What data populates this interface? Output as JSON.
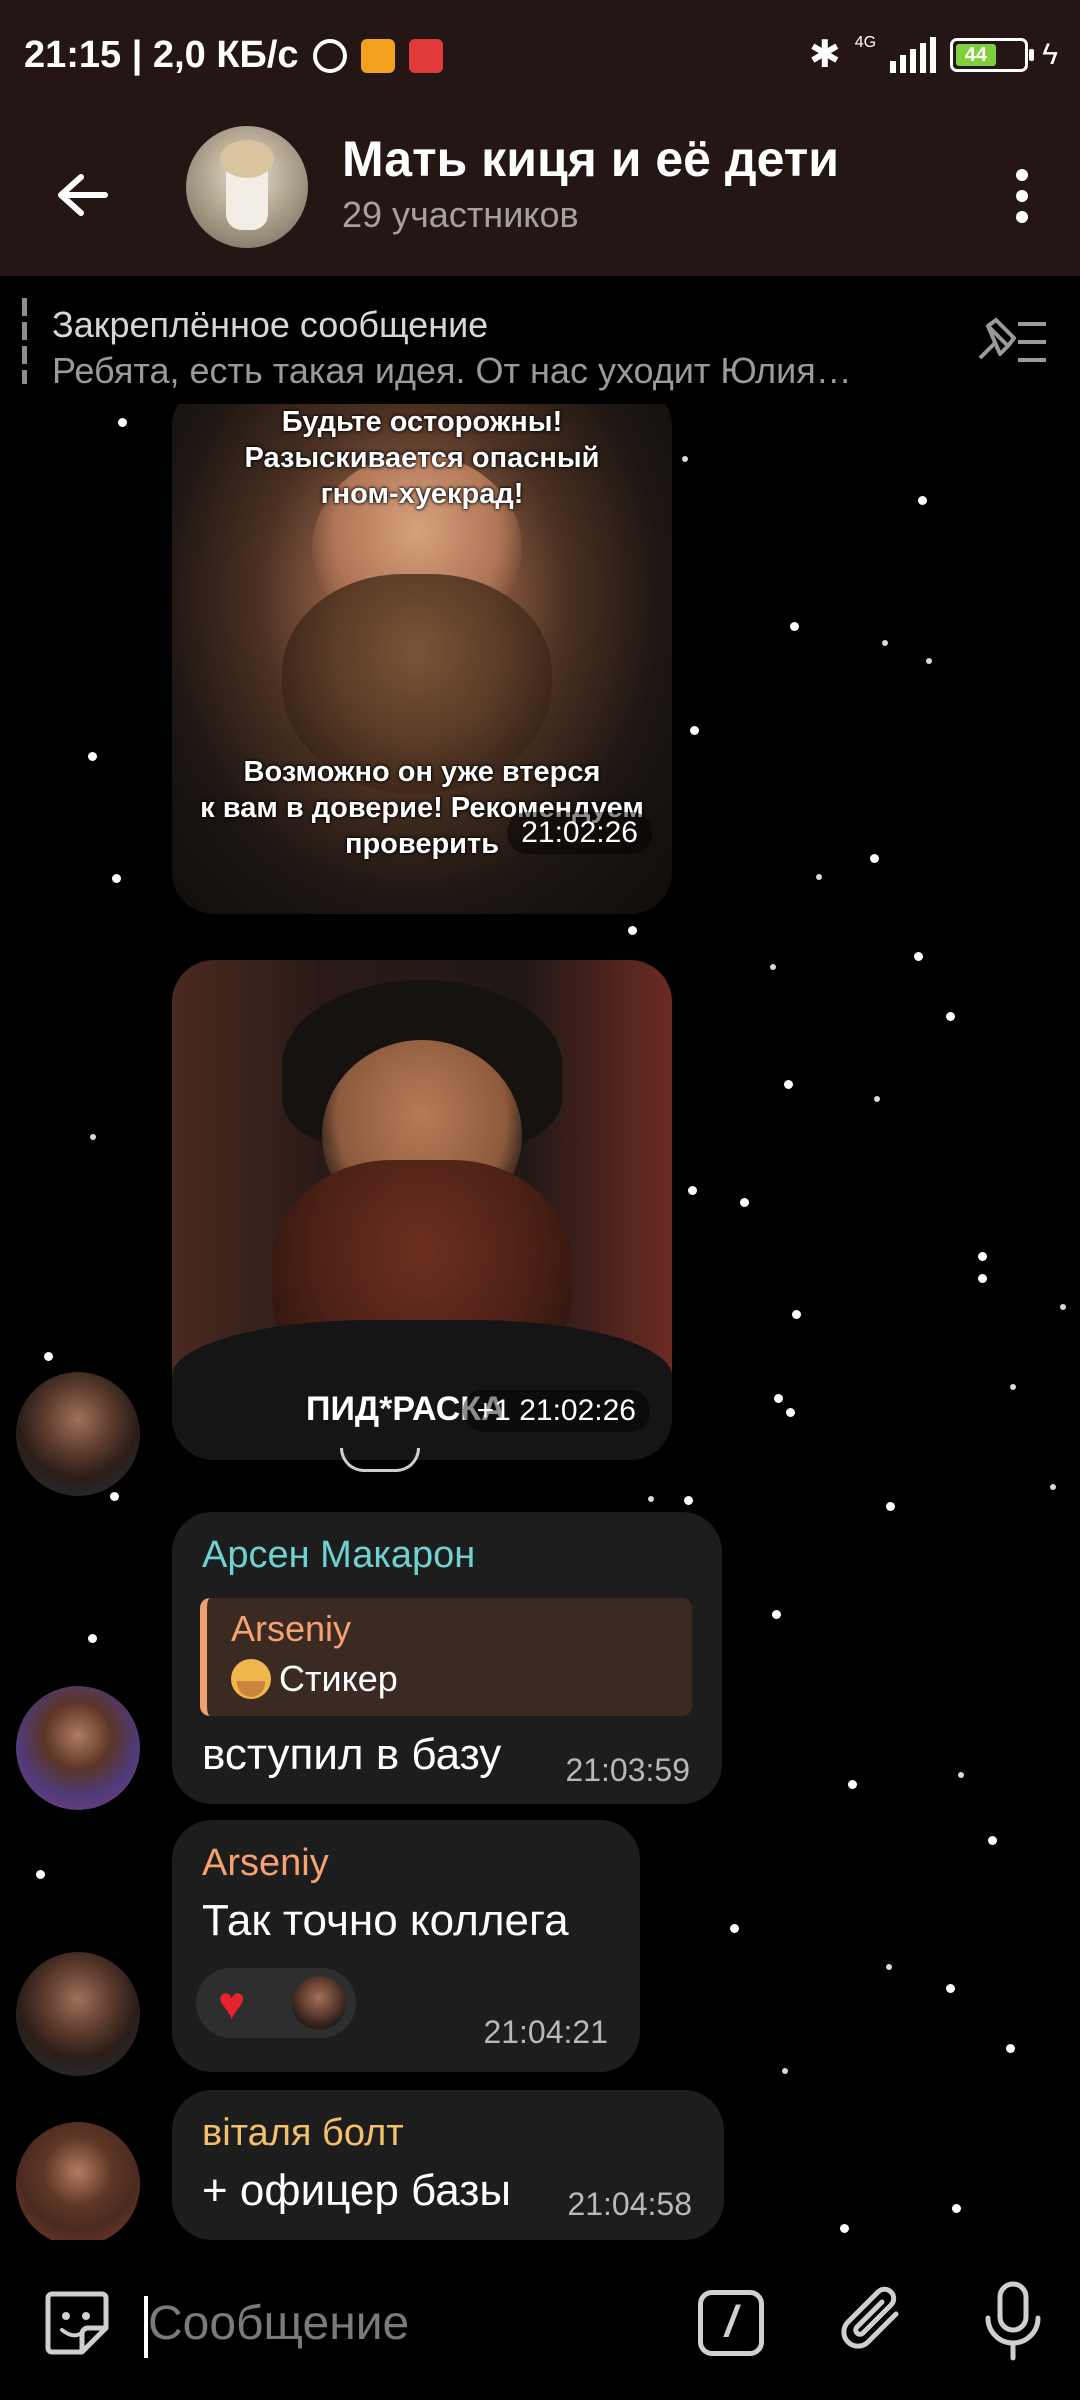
{
  "status_bar": {
    "time_speed": "21:15 | 2,0 КБ/с",
    "network": "4G",
    "battery": "44"
  },
  "header": {
    "title": "Мать киця и её дети",
    "subtitle": "29 участников"
  },
  "pinned": {
    "title": "Закреплённое сообщение",
    "text": "Ребята, есть такая идея. От нас уходит Юлия…"
  },
  "messages": [
    {
      "type": "image",
      "top_text": "Будьте осторожны!\nРазыскивается опасный\nгном-хуекрад!",
      "bottom_text": "Возможно он уже втерся\nк вам в доверие! Рекомендуем\nпроверить",
      "time": "21:02:26"
    },
    {
      "type": "image",
      "caption": "ПИД*РАСКА",
      "forward_count": "+1",
      "time": "21:02:26"
    },
    {
      "type": "text",
      "sender": "Арсен Макарон",
      "sender_color": "#6fd2d2",
      "reply_to": {
        "name": "Arseniy",
        "text": "Стикер"
      },
      "text": "вступил в базу",
      "time": "21:03:59"
    },
    {
      "type": "text",
      "sender": "Arseniy",
      "sender_color": "#f5a170",
      "text": "Так точно коллега",
      "reaction": "heart",
      "time": "21:04:21"
    },
    {
      "type": "text",
      "sender": "віталя болт",
      "sender_color": "#f3c06a",
      "text": "+ офицер базы",
      "time": "21:04:58"
    }
  ],
  "input": {
    "placeholder": "Сообщение"
  },
  "colors": {
    "header_bg": "#251616",
    "bubble_bg": "#1d1d1d",
    "chat_bg": "#000000"
  }
}
